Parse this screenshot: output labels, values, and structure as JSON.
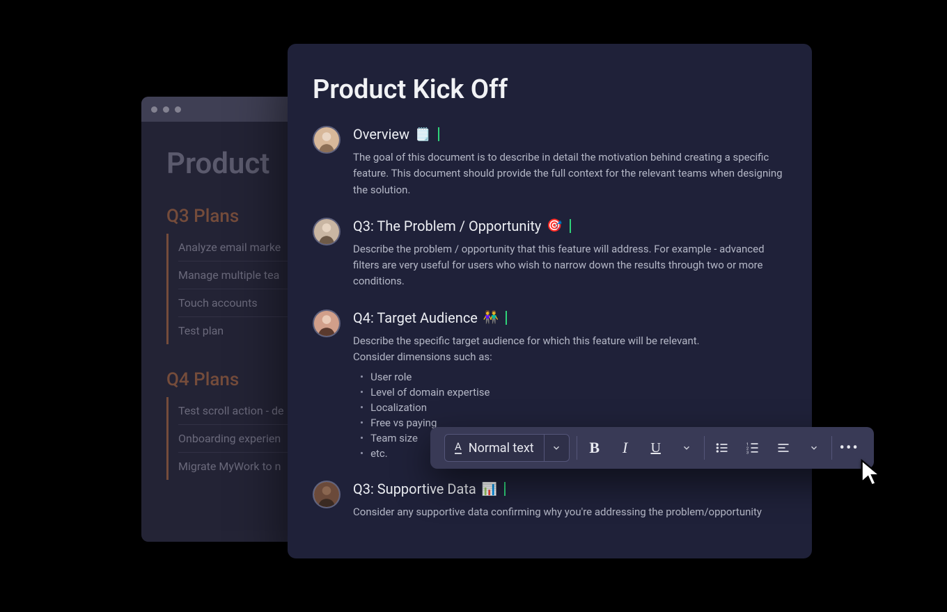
{
  "back": {
    "title": "Product",
    "groups": [
      {
        "heading": "Q3 Plans",
        "items": [
          "Analyze email marke",
          "Manage multiple tea",
          "Touch accounts",
          "Test plan"
        ]
      },
      {
        "heading": "Q4 Plans",
        "items": [
          "Test scroll action - de",
          "Onboarding experien",
          "Migrate MyWork to n"
        ]
      }
    ]
  },
  "front": {
    "title": "Product Kick Off",
    "sections": [
      {
        "heading": "Overview",
        "emoji": "🗒️",
        "body": "The goal of this document is to describe in detail the motivation behind creating a specific feature. This document should provide the full context for the relevant teams when designing the solution."
      },
      {
        "heading": "Q3: The Problem / Opportunity",
        "emoji": "🎯",
        "body": "Describe the problem / opportunity that this feature will address. For example - advanced filters are very useful for users who wish to narrow down the results through two or more conditions."
      },
      {
        "heading": "Q4: Target Audience",
        "emoji": "👫",
        "body": "Describe the specific target audience for which this feature will be relevant.",
        "body2": "Consider dimensions such as:",
        "bullets": [
          "User role",
          "Level of domain expertise",
          "Localization",
          "Free vs paying",
          "Team size",
          "etc."
        ]
      },
      {
        "heading": "Q3: Supportive Data",
        "emoji": "📊",
        "body": "Consider any supportive data confirming why you're addressing the problem/opportunity"
      }
    ]
  },
  "toolbar": {
    "style_label": "Normal text",
    "bold": "B",
    "italic": "I",
    "underline": "U",
    "more": "•••"
  }
}
